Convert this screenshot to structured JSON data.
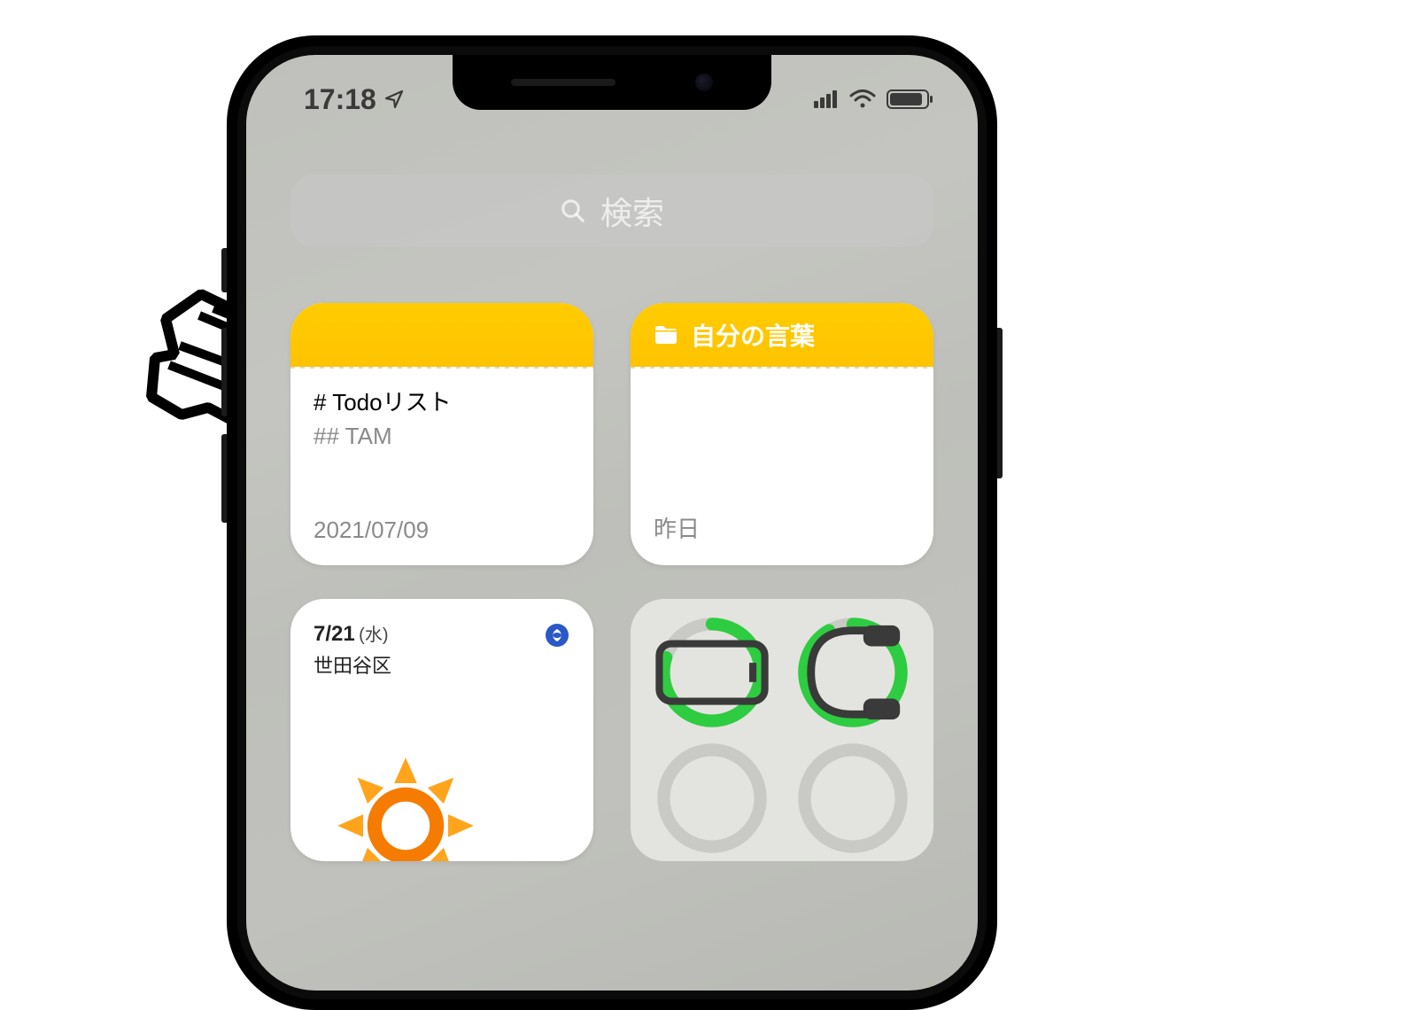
{
  "status": {
    "time": "17:18"
  },
  "search": {
    "placeholder": "検索"
  },
  "widgets": {
    "note1": {
      "title": "# Todoリスト",
      "subtitle": "## TAM",
      "date": "2021/07/09"
    },
    "note2": {
      "folder_label": "自分の言葉",
      "date": "昨日"
    },
    "weather": {
      "date": "7/21",
      "day": "(水)",
      "location": "世田谷区"
    },
    "battery_rings": {
      "phone_pct": 80,
      "headphones_pct": 92,
      "ring_color": "#2ECC40",
      "track_color": "#C9CAC5"
    }
  },
  "colors": {
    "notes_accent": "#FFCC00",
    "status_text": "#3a3a3a"
  }
}
